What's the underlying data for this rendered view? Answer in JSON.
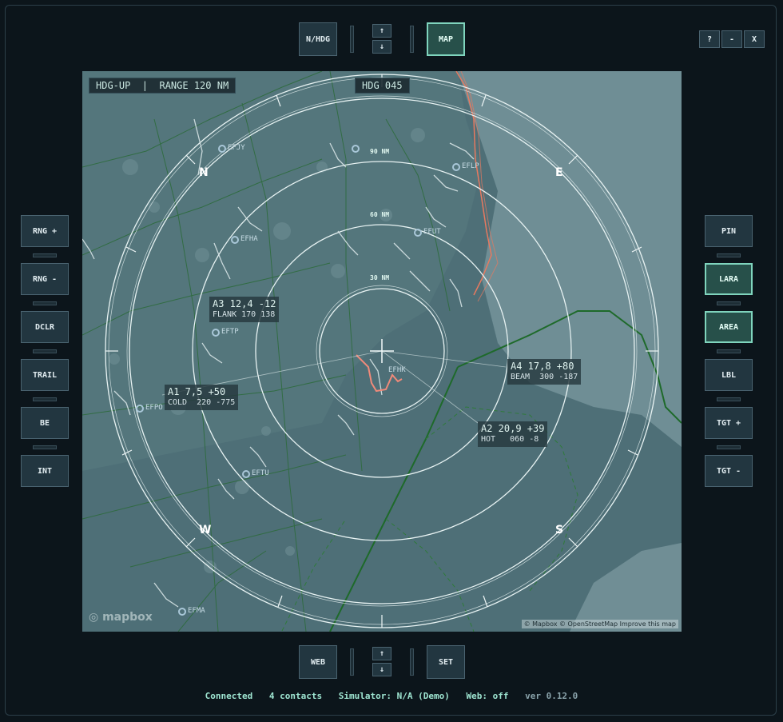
{
  "top": {
    "nhdg_label": "N/HDG",
    "map_label": "MAP",
    "arrow_up": "↑",
    "arrow_down": "↓",
    "help_label": "?",
    "min_label": "-",
    "close_label": "X"
  },
  "left_buttons": [
    "RNG +",
    "RNG -",
    "DCLR",
    "TRAIL",
    "BE",
    "INT"
  ],
  "right_buttons": [
    "PIN",
    "LARA",
    "AREA",
    "LBL",
    "TGT +",
    "TGT -"
  ],
  "right_active": [
    "LARA",
    "AREA"
  ],
  "bottom": {
    "web_label": "WEB",
    "set_label": "SET",
    "arrow_up": "↑",
    "arrow_down": "↓"
  },
  "map": {
    "mode_range": "HDG-UP  |  RANGE 120 NM",
    "heading": "HDG 045",
    "ring_labels": [
      "30 NM",
      "60 NM",
      "90 NM"
    ],
    "cardinals": {
      "n": "N",
      "e": "E",
      "s": "S",
      "w": "W"
    },
    "airports": [
      "EFJY",
      "EFHA",
      "EFTP",
      "EFPO",
      "EFTU",
      "EFMA",
      "EFHK",
      "EFUT",
      "EFLP"
    ],
    "targets": [
      {
        "line1": "A3 12,4 -12",
        "line2": "FLANK 170 138"
      },
      {
        "line1": "A1 7,5 +50",
        "line2": "COLD  220 -775"
      },
      {
        "line1": "A4 17,8 +80",
        "line2": "BEAM  300 -187"
      },
      {
        "line1": "A2 20,9 +39",
        "line2": "HOT   060 -8"
      }
    ],
    "logo": "mapbox",
    "attribution": "© Mapbox © OpenStreetMap  Improve this map"
  },
  "status": {
    "connection": "Connected",
    "contacts": "4 contacts",
    "simulator": "Simulator: N/A (Demo)",
    "web": "Web: off",
    "version": "ver 0.12.0"
  },
  "colors": {
    "background": "#0c151b",
    "button": "#223640",
    "active_border": "#7fd4bd",
    "map_water": "#4a6b72",
    "map_land": "#6d8c94",
    "status_text": "#9fe6d2"
  }
}
